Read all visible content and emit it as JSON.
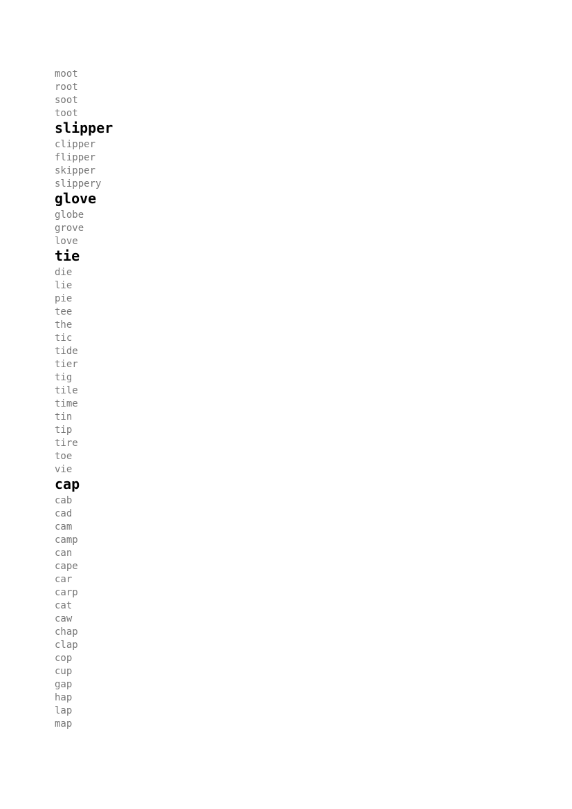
{
  "document": {
    "type": "rhyming-word-list",
    "page_background": "#ffffff",
    "headword_color": "#000000",
    "rhyme_color": "#777777"
  },
  "entries": [
    {
      "headword": null,
      "continued_from_previous_page": true,
      "rhymes": [
        "moot",
        "root",
        "soot",
        "toot"
      ]
    },
    {
      "headword": "slipper",
      "continued_from_previous_page": false,
      "rhymes": [
        "clipper",
        "flipper",
        "skipper",
        "slippery"
      ]
    },
    {
      "headword": "glove",
      "continued_from_previous_page": false,
      "rhymes": [
        "globe",
        "grove",
        "love"
      ]
    },
    {
      "headword": "tie",
      "continued_from_previous_page": false,
      "rhymes": [
        "die",
        "lie",
        "pie",
        "tee",
        "the",
        "tic",
        "tide",
        "tier",
        "tig",
        "tile",
        "time",
        "tin",
        "tip",
        "tire",
        "toe",
        "vie"
      ]
    },
    {
      "headword": "cap",
      "continued_from_previous_page": false,
      "rhymes": [
        "cab",
        "cad",
        "cam",
        "camp",
        "can",
        "cape",
        "car",
        "carp",
        "cat",
        "caw",
        "chap",
        "clap",
        "cop",
        "cup",
        "gap",
        "hap",
        "lap",
        "map"
      ]
    }
  ]
}
